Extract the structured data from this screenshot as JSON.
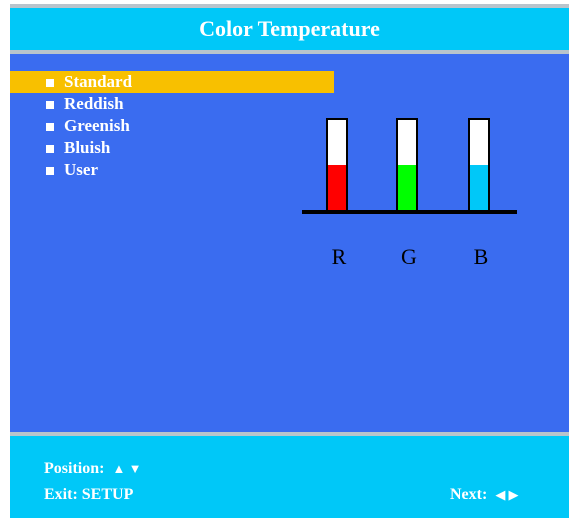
{
  "title": "Color Temperature",
  "menu": {
    "items": [
      {
        "label": "Standard",
        "selected": true
      },
      {
        "label": "Reddish",
        "selected": false
      },
      {
        "label": "Greenish",
        "selected": false
      },
      {
        "label": "Bluish",
        "selected": false
      },
      {
        "label": "User",
        "selected": false
      }
    ]
  },
  "channels": [
    {
      "label": "R",
      "level": 0.5,
      "color": "#ff0000"
    },
    {
      "label": "G",
      "level": 0.5,
      "color": "#00ff00"
    },
    {
      "label": "B",
      "level": 0.5,
      "color": "#00c8f8"
    }
  ],
  "footer": {
    "position_label": "Position:",
    "position_glyphs": "▲ ▼",
    "exit_label": "Exit: SETUP",
    "next_label": "Next:",
    "next_glyphs": "◀ ▶"
  },
  "colors": {
    "header_bg": "#00c8f8",
    "panel_bg": "#3a6cf0",
    "highlight": "#f8c000"
  }
}
